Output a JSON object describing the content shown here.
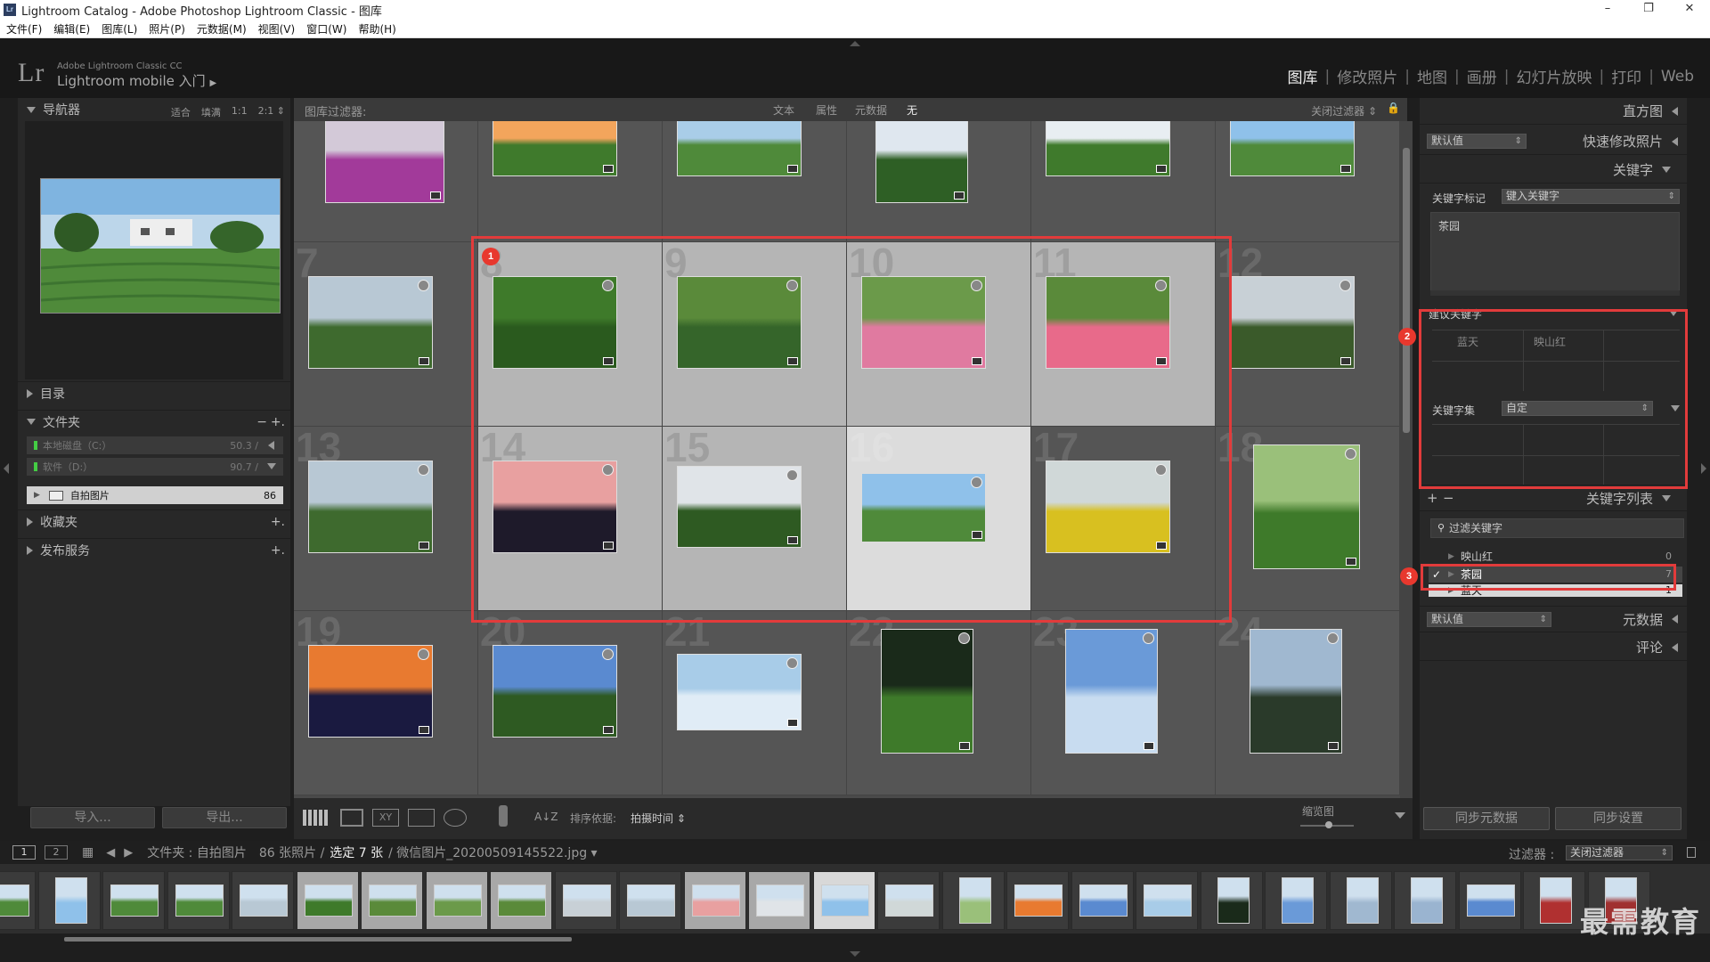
{
  "window": {
    "title": "Lightroom Catalog - Adobe Photoshop Lightroom Classic - 图库",
    "minimize": "–",
    "restore": "❐",
    "close": "✕"
  },
  "menu": [
    "文件(F)",
    "编辑(E)",
    "图库(L)",
    "照片(P)",
    "元数据(M)",
    "视图(V)",
    "窗口(W)",
    "帮助(H)"
  ],
  "identity": {
    "logo": "Lr",
    "line1": "Adobe Lightroom Classic CC",
    "line2": "Lightroom mobile 入门",
    "arrow": "▶"
  },
  "modules": [
    "图库",
    "修改照片",
    "地图",
    "画册",
    "幻灯片放映",
    "打印",
    "Web"
  ],
  "left": {
    "navigator": {
      "title": "导航器",
      "zoom": [
        "适合",
        "填满",
        "1:1",
        "2:1 ⇕"
      ]
    },
    "catalog": "目录",
    "folders": {
      "title": "文件夹",
      "minus": "−",
      "plus": "+.",
      "volumes": [
        {
          "name": "本地磁盘（C:）",
          "info": "50.3 /"
        },
        {
          "name": "软件（D:）",
          "info": "90.7 /"
        }
      ],
      "folder": {
        "name": "自拍图片",
        "count": "86"
      }
    },
    "collections": {
      "title": "收藏夹",
      "plus": "+."
    },
    "publish": {
      "title": "发布服务",
      "plus": "+."
    },
    "import_btn": "导入...",
    "export_btn": "导出..."
  },
  "filterbar": {
    "label": "图库过滤器:",
    "options": [
      "文本",
      "属性",
      "元数据",
      "无"
    ],
    "right": "关闭过滤器 ⇕",
    "lock": "🔒"
  },
  "grid": {
    "numbers": [
      "",
      "",
      "",
      "",
      "",
      "",
      "7",
      "8",
      "9",
      "10",
      "11",
      "12",
      "13",
      "14",
      "15",
      "16",
      "17",
      "18",
      "19",
      "20",
      "21",
      "22",
      "23",
      "24"
    ]
  },
  "toolbar": {
    "sort_label": "排序依据:",
    "sort_value": "拍摄时间 ⇕",
    "thumb_label": "缩览图",
    "az": "A↓Z"
  },
  "right": {
    "histogram": "直方图",
    "quick_develop": {
      "title": "快速修改照片",
      "preset": "默认值"
    },
    "keywording": {
      "title": "关键字",
      "tags_label": "关键字标记",
      "tags_select": "键入关键字",
      "box_text": "茶园"
    },
    "suggested": {
      "title": "建议关键字",
      "items": [
        "蓝天",
        "映山红"
      ]
    },
    "keyword_set": {
      "title": "关键字集",
      "value": "自定"
    },
    "keyword_list": {
      "title": "关键字列表",
      "plus": "+",
      "minus": "−",
      "filter_placeholder": "过滤关键字",
      "items": [
        {
          "name": "映山红",
          "count": "0",
          "check": ""
        },
        {
          "name": "茶园",
          "count": "7",
          "check": "✓"
        },
        {
          "name": "蓝天",
          "count": "1",
          "check": ""
        }
      ]
    },
    "metadata": {
      "title": "元数据",
      "preset": "默认值"
    },
    "comments": "评论",
    "sync_metadata": "同步元数据",
    "sync_settings": "同步设置"
  },
  "filmstrip": {
    "view1": "1",
    "view2": "2",
    "path": "文件夹 : 自拍图片",
    "count": "86 张照片 /",
    "selected": "选定 7 张",
    "file": "/ 微信图片_20200509145522.jpg ▾",
    "filter_label": "过滤器 :",
    "filter_value": "关闭过滤器"
  },
  "markers": [
    "1",
    "2",
    "3"
  ],
  "watermark": "最需教育",
  "colors": {
    "accent": "#e23b3b",
    "panel": "#282828",
    "grid": "#4a4a4a",
    "selected": "#b5b5b5",
    "active": "#dcdcdc"
  }
}
